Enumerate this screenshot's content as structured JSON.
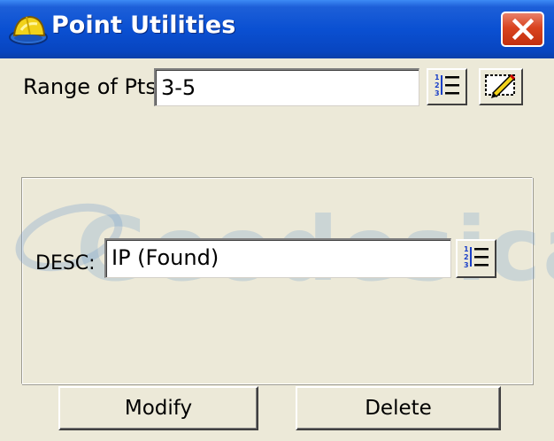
{
  "window": {
    "title": "Point Utilities",
    "title_icon": "hardhat-icon",
    "close_icon": "close-icon",
    "colors": {
      "titlebar": "#0a50d2",
      "close_button": "#d9431f",
      "background": "#ece9d8"
    }
  },
  "range": {
    "label": "Range of Pts:",
    "value": "3-5",
    "list_button_icon": "numbered-list-icon",
    "edit_button_icon": "edit-pencil-icon"
  },
  "desc": {
    "label": "DESC:",
    "value": "IP (Found)",
    "list_button_icon": "numbered-list-icon"
  },
  "watermark": {
    "text": "Geodesical"
  },
  "buttons": {
    "modify": "Modify",
    "delete": "Delete"
  }
}
